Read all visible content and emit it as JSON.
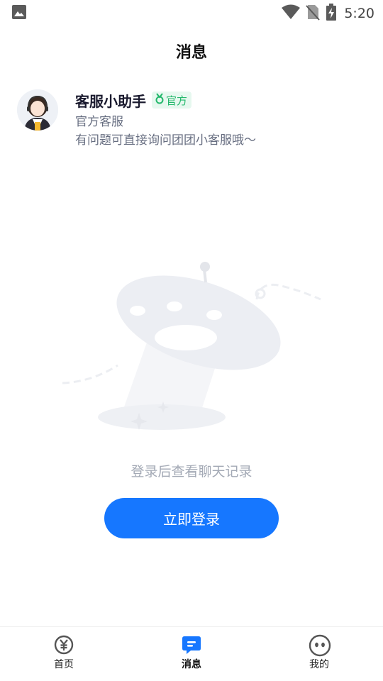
{
  "status_bar": {
    "time": "5:20",
    "icons": [
      "image-icon",
      "wifi-icon",
      "no-sim-icon",
      "battery-charging-icon"
    ]
  },
  "header": {
    "title": "消息"
  },
  "conversation": {
    "name": "客服小助手",
    "badge": "官方",
    "subtitle": "官方客服",
    "preview": "有问题可直接询问团团小客服哦～"
  },
  "empty_state": {
    "message": "登录后查看聊天记录",
    "login_button": "立即登录"
  },
  "tabs": [
    {
      "label": "首页",
      "icon": "yuan-icon",
      "active": false
    },
    {
      "label": "消息",
      "icon": "chat-icon",
      "active": true
    },
    {
      "label": "我的",
      "icon": "face-icon",
      "active": false
    }
  ],
  "colors": {
    "accent": "#1677ff",
    "badge_text": "#22b86b",
    "badge_bg": "#e6f8ef"
  }
}
